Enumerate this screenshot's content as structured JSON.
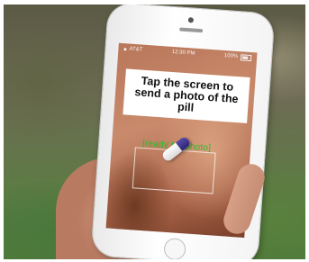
{
  "screen": {
    "status_bar": {
      "carrier": "AT&T",
      "time": "12:30 PM",
      "battery": "100%"
    },
    "prompt": "Tap the screen to send a photo of the pill",
    "status_label": "[ready for photo]"
  },
  "colors": {
    "status_label": "#23c02a",
    "pill_cap": "#3b2f8f"
  },
  "icons": {
    "home_button": "home-button",
    "camera": "front-camera"
  }
}
